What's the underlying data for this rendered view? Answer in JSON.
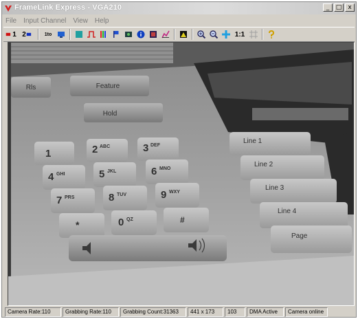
{
  "window": {
    "title": "FrameLink Express - VGA210",
    "minimize_glyph": "_",
    "maximize_glyph": "□",
    "close_glyph": "x"
  },
  "menu": [
    "File",
    "Input Channel",
    "View",
    "Help"
  ],
  "toolbar": {
    "channel1_label": "1",
    "channel2_label": "2",
    "ratio_label": "1:1",
    "ratio_text_icon_label": "1to"
  },
  "image": {
    "keys": {
      "k1": "1",
      "k1s": "",
      "k2": "2",
      "k2s": "ABC",
      "k3": "3",
      "k3s": "DEF",
      "k4": "4",
      "k4s": "GHI",
      "k5": "5",
      "k5s": "JKL",
      "k6": "6",
      "k6s": "MNO",
      "k7": "7",
      "k7s": "PRS",
      "k8": "8",
      "k8s": "TUV",
      "k9": "9",
      "k9s": "WXY",
      "kstar": "*",
      "k0": "0",
      "k0s": "QZ",
      "khash": "#"
    },
    "buttons": {
      "rls": "Rls",
      "feature": "Feature",
      "hold": "Hold",
      "line1": "Line 1",
      "line2": "Line 2",
      "line3": "Line 3",
      "line4": "Line 4",
      "page": "Page"
    }
  },
  "status": [
    "Camera Rate:110",
    "Grabbing Rate:110",
    "Grabbing Count:31363",
    "441 x 173",
    "103",
    "DMA Active",
    "Camera online"
  ]
}
